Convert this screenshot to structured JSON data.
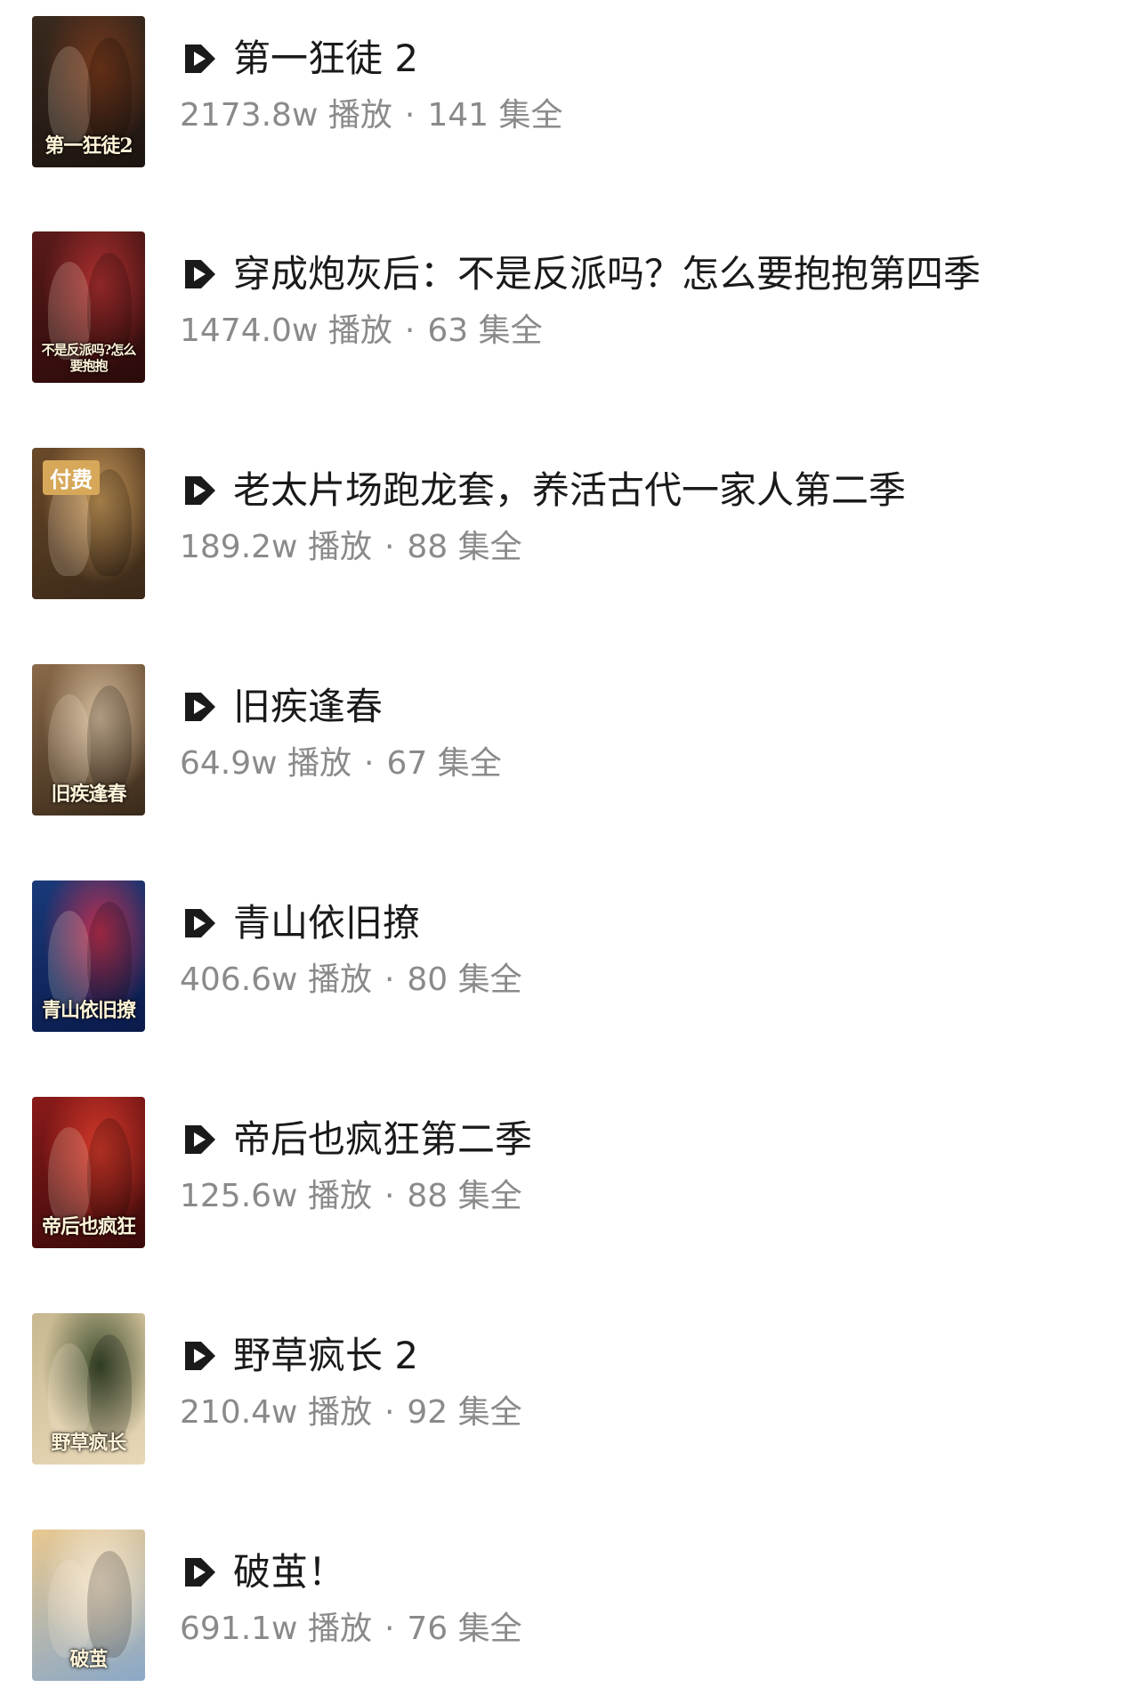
{
  "items": [
    {
      "title": "第一狂徒 2",
      "plays": "2173.8w 播放",
      "episodes": "141 集全",
      "poster_caption": "第一狂徒2",
      "poster_colors": [
        "#3a2a1f",
        "#7a3a1c",
        "#1c1410"
      ],
      "paid": false
    },
    {
      "title": "穿成炮灰后：不是反派吗？怎么要抱抱第四季",
      "plays": "1474.0w 播放",
      "episodes": "63 集全",
      "poster_caption": "不是反派吗?怎么要抱抱",
      "poster_colors": [
        "#5a1a1a",
        "#b03030",
        "#2a0a0a"
      ],
      "paid": false
    },
    {
      "title": "老太片场跑龙套，养活古代一家人第二季",
      "plays": "189.2w 播放",
      "episodes": "88 集全",
      "poster_caption": "",
      "poster_colors": [
        "#6a4a2a",
        "#c99a5a",
        "#3a2818"
      ],
      "paid": true,
      "badge": "付费"
    },
    {
      "title": "旧疾逢春",
      "plays": "64.9w 播放",
      "episodes": "67 集全",
      "poster_caption": "旧疾逢春",
      "poster_colors": [
        "#8a6a4a",
        "#d8c0a0",
        "#3a2a1a"
      ],
      "paid": false
    },
    {
      "title": "青山依旧撩",
      "plays": "406.6w 播放",
      "episodes": "80 集全",
      "poster_caption": "青山依旧撩",
      "poster_colors": [
        "#1a3a7a",
        "#c03050",
        "#0a1a4a"
      ],
      "paid": false
    },
    {
      "title": "帝后也疯狂第二季",
      "plays": "125.6w 播放",
      "episodes": "88 集全",
      "poster_caption": "帝后也疯狂",
      "poster_colors": [
        "#8a1a1a",
        "#d83a2a",
        "#3a0a0a"
      ],
      "paid": false
    },
    {
      "title": "野草疯长 2",
      "plays": "210.4w 播放",
      "episodes": "92 集全",
      "poster_caption": "野草疯长",
      "poster_colors": [
        "#c8b890",
        "#3a4a2a",
        "#e8d8b8"
      ],
      "paid": false
    },
    {
      "title": "破茧！",
      "plays": "691.1w 播放",
      "episodes": "76 集全",
      "poster_caption": "破茧",
      "poster_colors": [
        "#e8c890",
        "#f8e8d0",
        "#8aa8c8"
      ],
      "paid": false
    }
  ],
  "separator": "·",
  "icon": "play-badge-icon",
  "accent_color": "#1a1a1a"
}
